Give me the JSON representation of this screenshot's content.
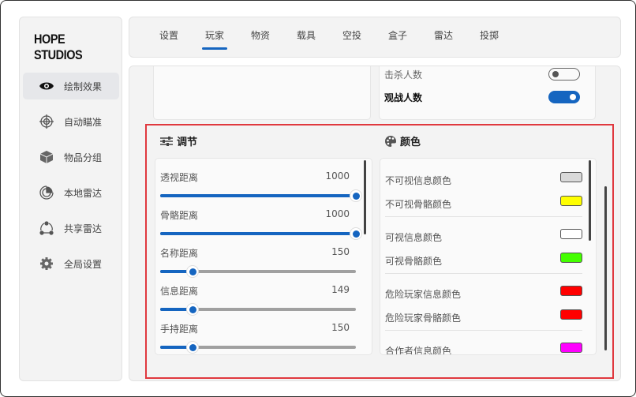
{
  "app": {
    "logo": "HOPE STUDIOS"
  },
  "sidebar": {
    "items": [
      {
        "label": "绘制效果",
        "icon": "eye-icon",
        "active": true
      },
      {
        "label": "自动瞄准",
        "icon": "crosshair-icon"
      },
      {
        "label": "物品分组",
        "icon": "box-icon"
      },
      {
        "label": "本地雷达",
        "icon": "radar-icon"
      },
      {
        "label": "共享雷达",
        "icon": "share-icon"
      },
      {
        "label": "全局设置",
        "icon": "gear-icon"
      }
    ]
  },
  "tabs": [
    {
      "label": "设置"
    },
    {
      "label": "玩家",
      "active": true
    },
    {
      "label": "物资"
    },
    {
      "label": "载具"
    },
    {
      "label": "空投"
    },
    {
      "label": "盒子"
    },
    {
      "label": "雷达"
    },
    {
      "label": "投掷"
    }
  ],
  "toggles": [
    {
      "label": "击杀人数",
      "on": false
    },
    {
      "label": "观战人数",
      "on": true
    }
  ],
  "adjust": {
    "title": "调节",
    "icon": "sliders-icon",
    "max": 1000,
    "sliders": [
      {
        "label": "透视距离",
        "value": 1000
      },
      {
        "label": "骨骼距离",
        "value": 1000
      },
      {
        "label": "名称距离",
        "value": 150
      },
      {
        "label": "信息距离",
        "value": 149
      },
      {
        "label": "手持距离",
        "value": 150
      }
    ]
  },
  "colors": {
    "title": "颜色",
    "icon": "palette-icon",
    "items": [
      {
        "label": "不可视信息颜色",
        "color": "#d9d9d9"
      },
      {
        "label": "不可视骨骼颜色",
        "color": "#ffff00"
      },
      {
        "label": "可视信息颜色",
        "color": "#ffffff"
      },
      {
        "label": "可视骨骼颜色",
        "color": "#44ff00"
      },
      {
        "label": "危险玩家信息颜色",
        "color": "#ff0000"
      },
      {
        "label": "危险玩家骨骼颜色",
        "color": "#ff0000"
      },
      {
        "label": "合作者信息颜色",
        "color": "#ff00ff"
      }
    ]
  },
  "accent": "#1565c0",
  "highlight": "#e0383e"
}
